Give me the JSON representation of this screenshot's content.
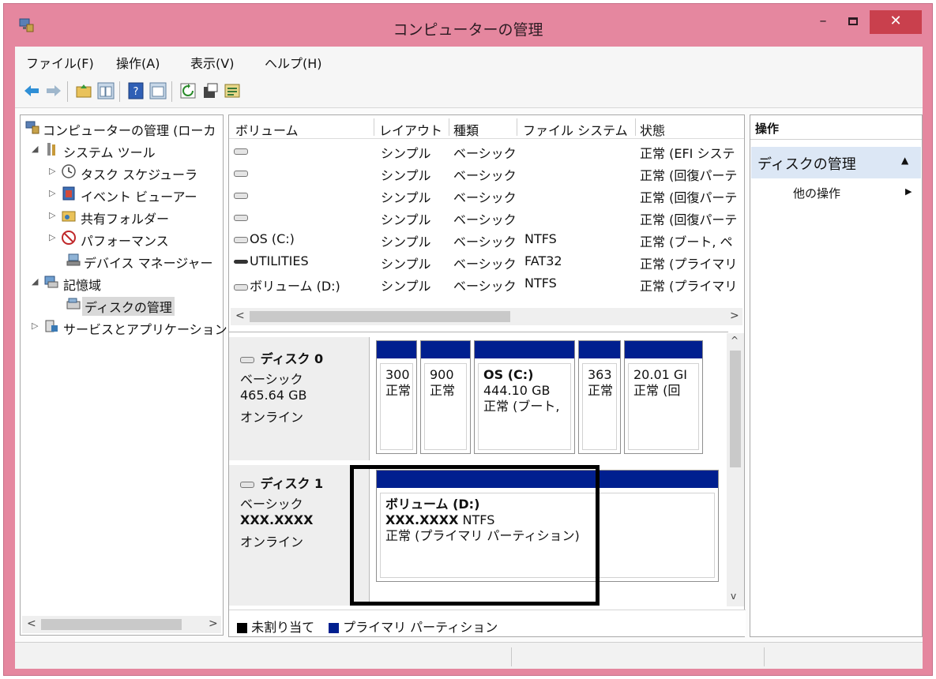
{
  "window": {
    "title": "コンピューターの管理"
  },
  "menu": [
    "ファイル(F)",
    "操作(A)",
    "表示(V)",
    "ヘルプ(H)"
  ],
  "tree": [
    {
      "label": "コンピューターの管理 (ローカ",
      "icon": "computer-icon"
    },
    {
      "label": "システム ツール",
      "icon": "tools-icon"
    },
    {
      "label": "タスク スケジューラ",
      "icon": "clock-icon"
    },
    {
      "label": "イベント ビューアー",
      "icon": "event-log-icon"
    },
    {
      "label": "共有フォルダー",
      "icon": "shared-folder-icon"
    },
    {
      "label": "パフォーマンス",
      "icon": "performance-icon"
    },
    {
      "label": "デバイス マネージャー",
      "icon": "device-manager-icon"
    },
    {
      "label": "記憶域",
      "icon": "storage-icon"
    },
    {
      "label": "ディスクの管理",
      "icon": "disk-management-icon"
    },
    {
      "label": "サービスとアプリケーション",
      "icon": "services-icon"
    }
  ],
  "volumes": {
    "columns": [
      "ボリューム",
      "レイアウト",
      "種類",
      "ファイル システム",
      "状態"
    ],
    "rows": [
      {
        "name": "",
        "layout": "シンプル",
        "type": "ベーシック",
        "fs": "",
        "status": "正常 (EFI システ"
      },
      {
        "name": "",
        "layout": "シンプル",
        "type": "ベーシック",
        "fs": "",
        "status": "正常 (回復パーテ"
      },
      {
        "name": "",
        "layout": "シンプル",
        "type": "ベーシック",
        "fs": "",
        "status": "正常 (回復パーテ"
      },
      {
        "name": "",
        "layout": "シンプル",
        "type": "ベーシック",
        "fs": "",
        "status": "正常 (回復パーテ"
      },
      {
        "name": "OS (C:)",
        "layout": "シンプル",
        "type": "ベーシック",
        "fs": "NTFS",
        "status": "正常 (ブート, ペ"
      },
      {
        "name": "UTILITIES",
        "layout": "シンプル",
        "type": "ベーシック",
        "fs": "FAT32",
        "status": "正常 (プライマリ ."
      },
      {
        "name": "ボリューム (D:)",
        "layout": "シンプル",
        "type": "ベーシック",
        "fs": "NTFS",
        "status": "正常 (プライマリ ."
      }
    ]
  },
  "disks": [
    {
      "name": "ディスク 0",
      "type": "ベーシック",
      "size": "465.64 GB",
      "state": "オンライン",
      "partitions": [
        {
          "line1": "",
          "line2": "300",
          "line3": "正常"
        },
        {
          "line1": "",
          "line2": "900",
          "line3": "正常"
        },
        {
          "line1": "OS (C:)",
          "line2": "444.10 GB",
          "line3": "正常 (ブート,"
        },
        {
          "line1": "",
          "line2": "363",
          "line3": "正常"
        },
        {
          "line1": "",
          "line2": "20.01 GI",
          "line3": "正常 (回"
        }
      ]
    },
    {
      "name": "ディスク 1",
      "type": "ベーシック",
      "size": "XXX.XXXX",
      "state": "オンライン",
      "partitions": [
        {
          "line1": "ボリューム (D:)",
          "line2_bold": "XXX.XXXX",
          "line2_rest": " NTFS",
          "line3": "正常 (プライマリ パーティション)"
        }
      ]
    }
  ],
  "legend": {
    "unallocated": "未割り当て",
    "primary": "プライマリ パーティション"
  },
  "actions": {
    "header": "操作",
    "section": "ディスクの管理",
    "more": "他の操作"
  },
  "colors": {
    "primary_partition": "#001f8f",
    "unallocated": "#000000",
    "window_frame": "#e5879f"
  }
}
